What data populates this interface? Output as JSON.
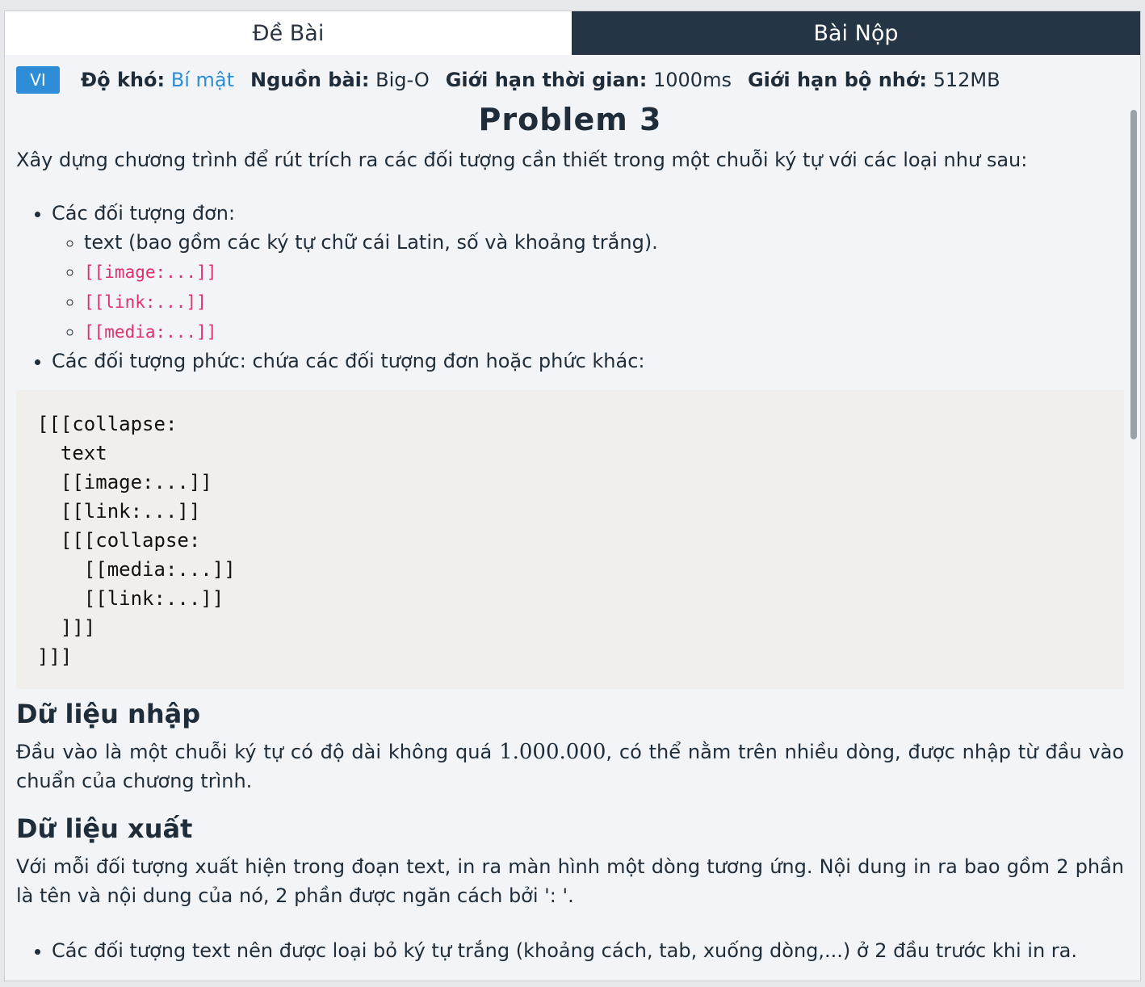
{
  "tabs": {
    "problem": "Đề Bài",
    "submit": "Bài Nộp"
  },
  "meta": {
    "lang_badge": "VI",
    "difficulty_label": "Độ khó:",
    "difficulty_value": "Bí mật",
    "source_label": "Nguồn bài:",
    "source_value": "Big-O",
    "time_label": "Giới hạn thời gian:",
    "time_value": "1000ms",
    "memory_label": "Giới hạn bộ nhớ:",
    "memory_value": "512MB"
  },
  "problem": {
    "title": "Problem 3",
    "intro": "Xây dựng chương trình để rút trích ra các đối tượng cần thiết trong một chuỗi ký tự với các loại như sau:",
    "simple_label": "Các đối tượng đơn:",
    "simple_items": [
      "text (bao gồm các ký tự chữ cái Latin, số và khoảng trắng).",
      "[[image:...]]",
      "[[link:...]]",
      "[[media:...]]"
    ],
    "complex_label": "Các đối tượng phức: chứa các đối tượng đơn hoặc phức khác:",
    "code_block": "[[[collapse:\n  text\n  [[image:...]]\n  [[link:...]]\n  [[[collapse:\n    [[media:...]]\n    [[link:...]]\n  ]]]\n]]]",
    "input_heading": "Dữ liệu nhập",
    "input_text_a": "Đầu vào là một chuỗi ký tự có độ dài không quá ",
    "input_number": "1.000.000",
    "input_text_b": ", có thể nằm trên nhiều dòng, được nhập từ đầu vào chuẩn của chương trình.",
    "output_heading": "Dữ liệu xuất",
    "output_text": "Với mỗi đối tượng xuất hiện trong đoạn text, in ra màn hình một dòng tương ứng. Nội dung in ra bao gồm 2 phần là tên và nội dung của nó, 2 phần được ngăn cách bởi ': '.",
    "output_bullet": "Các đối tượng text nên được loại bỏ ký tự trắng (khoảng cách, tab, xuống dòng,...) ở 2 đầu trước khi in ra."
  }
}
